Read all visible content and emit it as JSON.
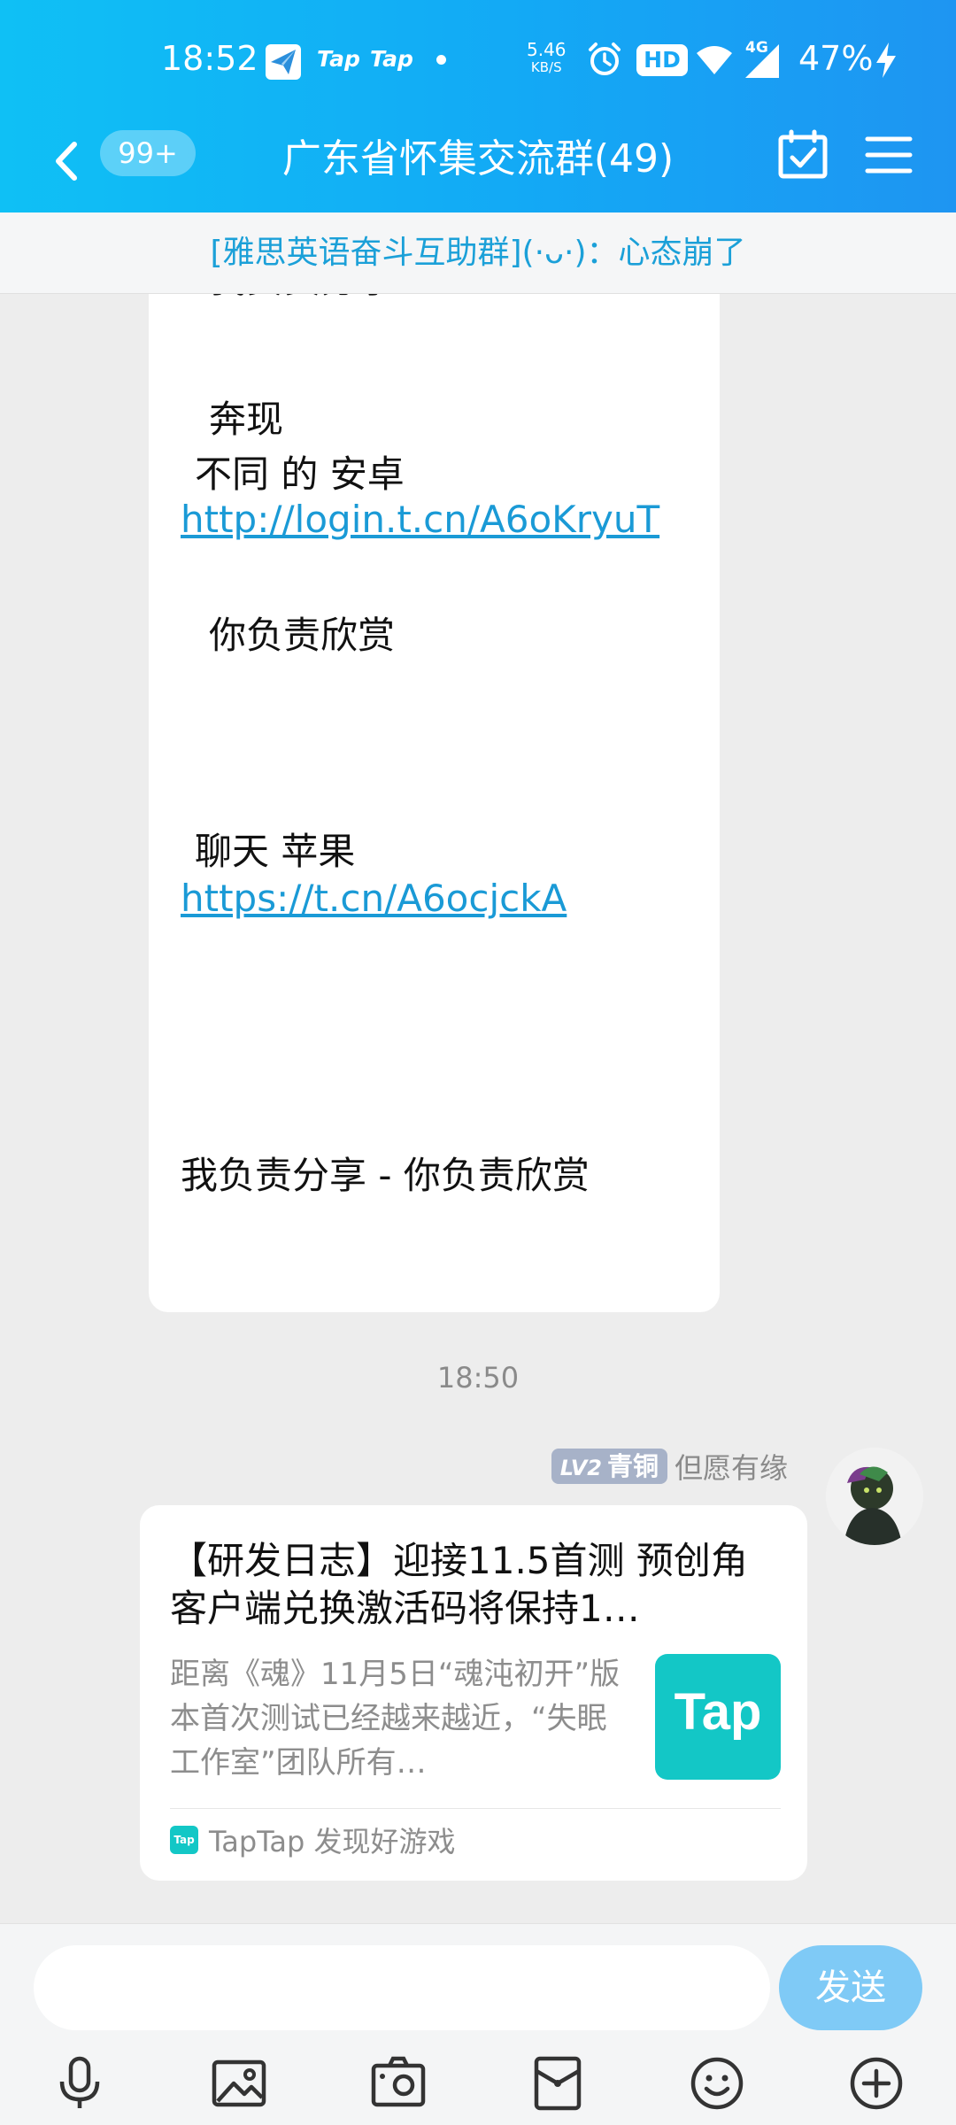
{
  "status_bar": {
    "time": "18:52",
    "apps": [
      "Tap",
      "Tap"
    ],
    "net_speed": "5.46",
    "net_speed_unit": "KB/S",
    "hd_label": "HD",
    "network_label": "4G",
    "battery": "47%"
  },
  "header": {
    "unread_count": "99+",
    "title": "广东省怀集交流群(49)"
  },
  "notice": {
    "text": "[雅思英语奋斗互助群](·ᴗ·)：心态崩了"
  },
  "message1": {
    "line_top": "我负责分享",
    "line_a": "奔现",
    "line_b": "不同 的  安卓",
    "link_android": "http://login.t.cn/A6oKryuT",
    "line_c": "你负责欣赏",
    "line_d": "聊天  苹果",
    "link_ios": "https://t.cn/A6ocjckA",
    "line_e": "我负责分享 - 你负责欣赏"
  },
  "timestamp": "18:50",
  "sender": {
    "level": "LV2",
    "rank": "青铜",
    "name": "但愿有缘"
  },
  "share_card": {
    "title": "【研发日志】迎接11.5首测 预创角客户端兑换激活码将保持1…",
    "description": "距离《魂》11月5日“魂沌初开”版本首次测试已经越来越近，“失眠工作室”团队所有…",
    "logo_text": "Tap",
    "footer_icon_text": "Tap",
    "source": "TapTap 发现好游戏"
  },
  "input": {
    "placeholder": "",
    "send_label": "发送"
  },
  "colors": {
    "header_gradient_start": "#0fc0f5",
    "header_gradient_end": "#1e95f2",
    "link": "#1a9ad6",
    "send_button": "#7fcaf6",
    "tap_brand": "#13c7c6",
    "level_badge": "#a7b2c8"
  },
  "icons": {
    "toolbar": [
      "microphone-icon",
      "image-icon",
      "camera-icon",
      "red-packet-icon",
      "emoji-icon",
      "plus-icon"
    ]
  }
}
